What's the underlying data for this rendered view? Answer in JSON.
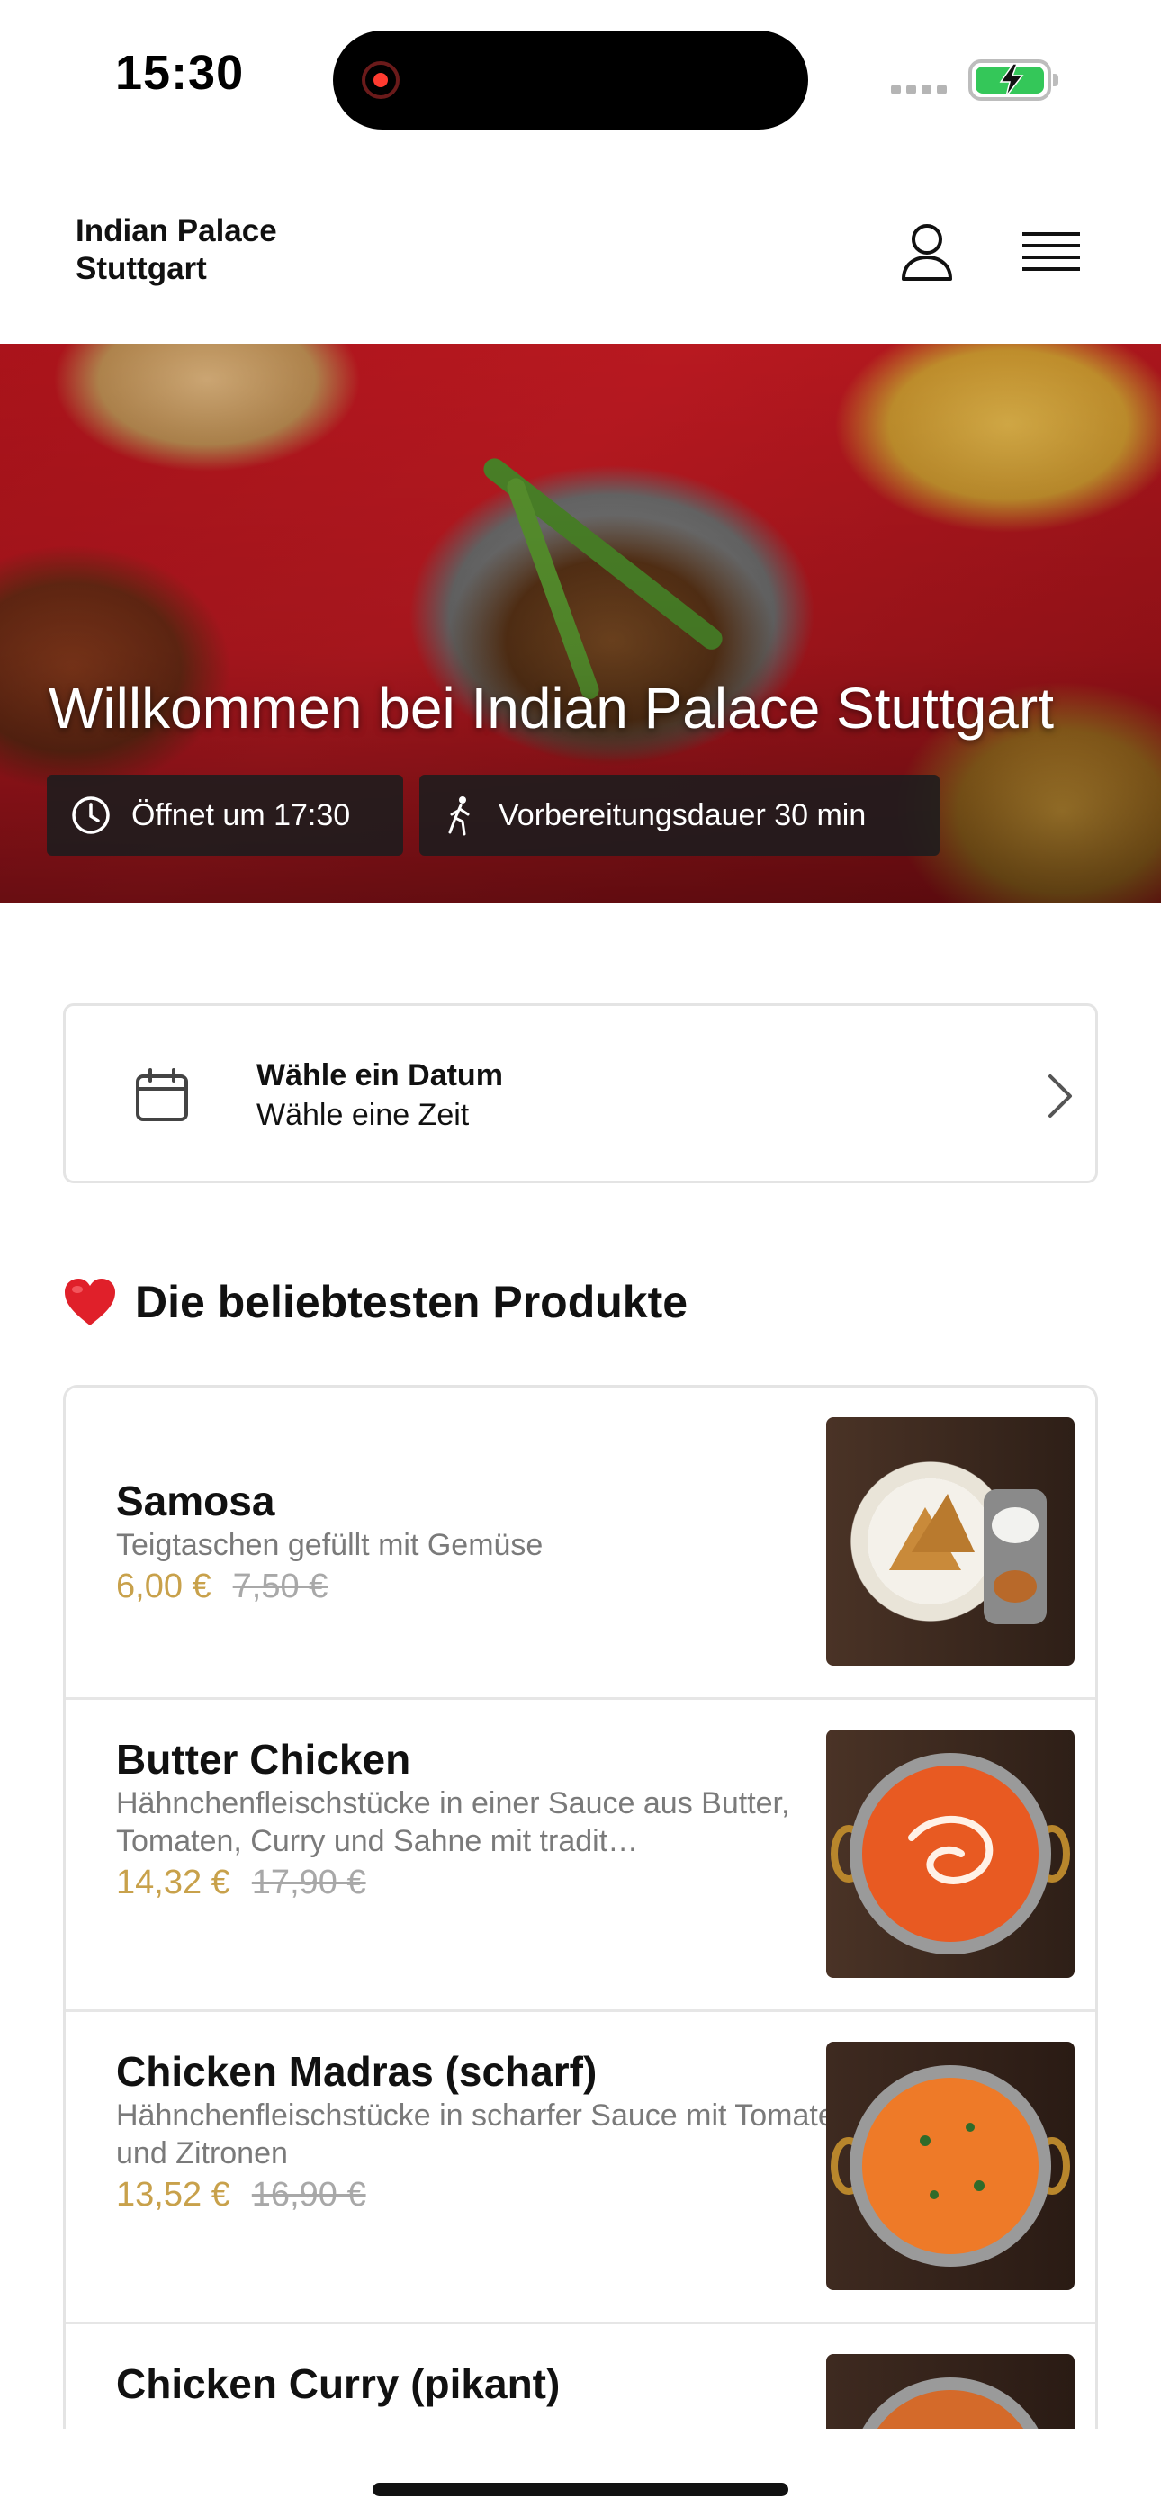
{
  "status_bar": {
    "time": "15:30",
    "battery_icon": "battery-charging-icon",
    "signal_icon": "cellular-signal-icon"
  },
  "header": {
    "brand_line1": "Indian Palace",
    "brand_line2": "Stuttgart",
    "account_icon": "user-icon",
    "menu_icon": "hamburger-menu-icon"
  },
  "hero": {
    "title": "Willkommen bei Indian Palace Stuttgart",
    "opening": "Öffnet um 17:30",
    "prep_time": "Vorbereitungsdauer 30 min"
  },
  "date_picker": {
    "title": "Wähle ein Datum",
    "subtitle": "Wähle eine Zeit"
  },
  "popular": {
    "emoji": "❤️",
    "title": "Die beliebtesten Produkte",
    "products": [
      {
        "name": "Samosa",
        "description": "Teigtaschen gefüllt mit Gemüse",
        "price": "6,00 €",
        "old_price": "7,50 €"
      },
      {
        "name": "Butter Chicken",
        "description": "Hähnchenfleischstücke in einer Sauce aus Butter, Tomaten, Curry und Sahne mit tradit…",
        "price": "14,32 €",
        "old_price": "17,90 €"
      },
      {
        "name": "Chicken Madras (scharf)",
        "description": "Hähnchenfleischstücke in scharfer Sauce mit Tomaten und Zitronen",
        "price": "13,52 €",
        "old_price": "16,90 €"
      },
      {
        "name": "Chicken Curry (pikant)",
        "description": "",
        "price": "",
        "old_price": ""
      }
    ]
  },
  "colors": {
    "price_accent": "#c8a14b",
    "old_price": "#a8a8a8",
    "hero_red": "#b3141c",
    "battery_green": "#34c759"
  }
}
